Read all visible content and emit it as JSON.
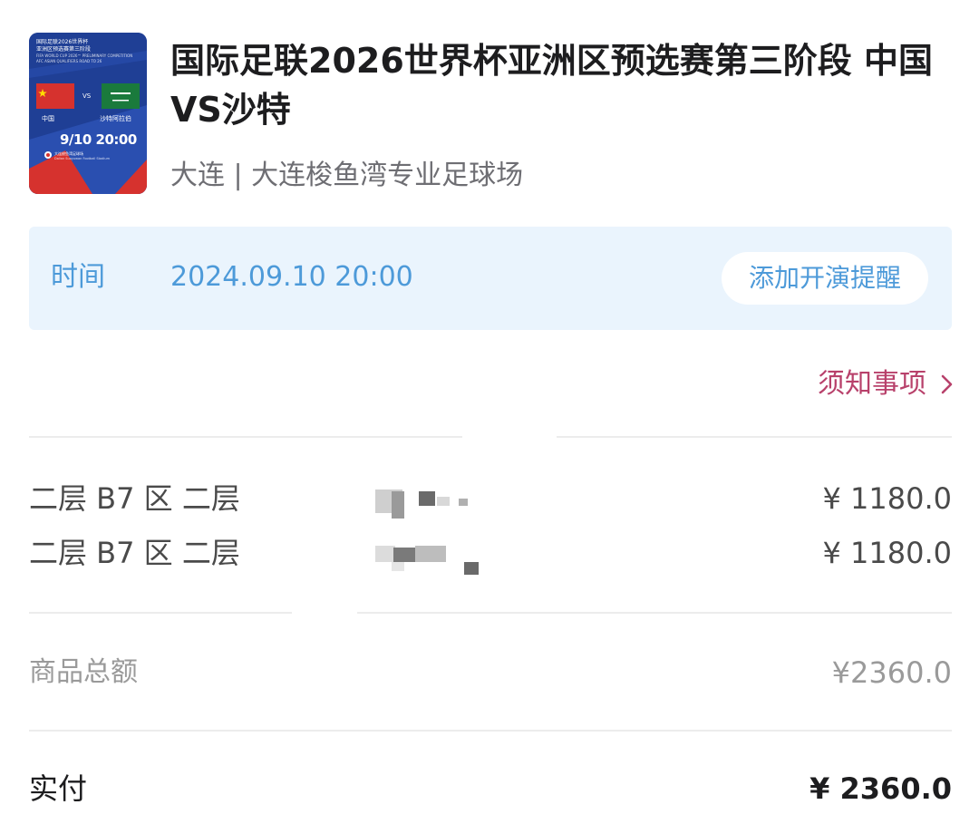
{
  "event": {
    "title": "国际足联2026世界杯亚洲区预选赛第三阶段 中国VS沙特",
    "venue": "大连 | 大连梭鱼湾专业足球场"
  },
  "poster": {
    "header_line1": "国际足联2026世界杯",
    "header_line2": "亚洲区预选赛第三阶段",
    "header_line3": "FIFA WORLD CUP 2026™ PRELIMINARY COMPETITION",
    "header_line4": "AFC ASIAN QUALIFIERS ROAD TO 26",
    "vs": "VS",
    "team_home": "中国",
    "team_away": "沙特阿拉伯",
    "date_time": "9/10 20:00",
    "venue_cn": "大连梭鱼湾足球场",
    "venue_en": "Dalian Suoyuwan Football Stadium",
    "colors": {
      "blue": "#1f3f95",
      "red": "#d6322e",
      "green": "#1a7a3c"
    }
  },
  "time_bar": {
    "label": "时间",
    "value": "2024.09.10 20:00",
    "remind_button": "添加开演提醒"
  },
  "notice_link": "须知事项",
  "tickets": [
    {
      "seat": "二层 B7 区 二层",
      "price": "¥ 1180.0"
    },
    {
      "seat": "二层 B7 区 二层",
      "price": "¥ 1180.0"
    }
  ],
  "subtotal": {
    "label": "商品总额",
    "value": "¥2360.0"
  },
  "paid": {
    "label": "实付",
    "value": "¥ 2360.0"
  },
  "colors": {
    "accent_blue": "#4d9ad9",
    "time_bar_bg": "#eaf4fd",
    "notice_pink": "#b8416b",
    "text_dark": "#1d1d1f",
    "text_gray": "#9a9a9a"
  }
}
